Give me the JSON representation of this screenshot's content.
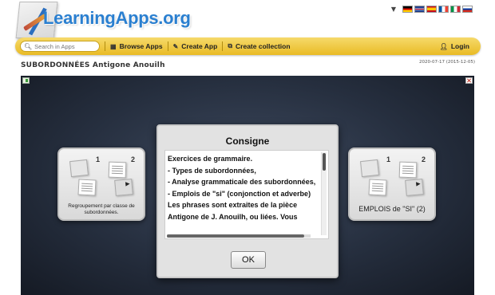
{
  "header": {
    "logo_text": "LearningApps.org",
    "languages": [
      {
        "name": "german-flag",
        "colors": [
          "#000000",
          "#dd0000",
          "#ffce00"
        ]
      },
      {
        "name": "uk-flag",
        "colors": [
          "#1f3f8f",
          "#c8102e",
          "#ffffff"
        ]
      },
      {
        "name": "spanish-flag",
        "colors": [
          "#c60b1e",
          "#ffc400",
          "#c60b1e"
        ]
      },
      {
        "name": "french-flag",
        "colors": [
          "#0055a4",
          "#ffffff",
          "#ef4135"
        ]
      },
      {
        "name": "italian-flag",
        "colors": [
          "#009246",
          "#ffffff",
          "#ce2b37"
        ]
      },
      {
        "name": "russian-flag",
        "colors": [
          "#ffffff",
          "#0039a6",
          "#d52b1e"
        ]
      }
    ]
  },
  "toolbar": {
    "search_placeholder": "Search in Apps",
    "browse_label": "Browse Apps",
    "create_app_label": "Create App",
    "create_collection_label": "Create collection",
    "login_label": "Login"
  },
  "page": {
    "title": "SUBORDONNÉES Antigone Anouilh",
    "date": "2020-07-17 (2015-12-05)"
  },
  "stage": {
    "cards": [
      {
        "label": "Regroupement par classe de subordonnées.",
        "num1": "1",
        "num2": "2"
      },
      {
        "label": "EMPLOIS de \"SI\" (2)",
        "num1": "1",
        "num2": "2"
      }
    ],
    "modal": {
      "title": "Consigne",
      "text": "Exercices de grammaire.\n- Types de subordonnées,\n- Analyse grammaticale des subordonnées,\n- Emplois de \"si\" (conjonction et adverbe)\nLes phrases sont extraites de la pièce Antigone de J. Anouilh, ou liées. Vous",
      "ok_label": "OK"
    }
  }
}
